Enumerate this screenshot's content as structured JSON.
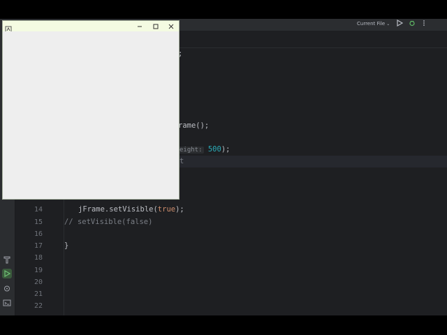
{
  "ide": {
    "run_config": "Current File",
    "toolbar_icons": [
      "run-icon",
      "debug-icon",
      "more-icon"
    ],
    "left_strip_icons": [
      "hammer-icon",
      "run-icon",
      "debug-icon",
      "terminal-icon"
    ]
  },
  "editor": {
    "line_numbers": [
      "14",
      "15",
      "16",
      "17",
      "18",
      "19",
      "20",
      "21",
      "22"
    ],
    "fragments": {
      "line_a_tail": ";",
      "line_b_tail": "rame();",
      "line_c_hint": "eight:",
      "line_c_value": "500",
      "line_c_tail": ");",
      "line_d_tail": "t"
    },
    "line14": {
      "prefix": "jFrame.setVisible(",
      "keyword": "true",
      "suffix": ");"
    },
    "line15": "// setVisible(false)",
    "line17": "}"
  },
  "swing_window": {
    "title": "",
    "icon": "java-app-icon",
    "controls": [
      "minimize-icon",
      "maximize-icon",
      "close-icon"
    ]
  },
  "colors": {
    "ide_bg": "#1e1f22",
    "panel_bg": "#2b2d30",
    "keyword": "#cf8e6d",
    "number": "#2aacb8",
    "comment": "#7a7e85",
    "swing_title_bg": "#f4fbe2",
    "swing_body_bg": "#eeeeee"
  }
}
